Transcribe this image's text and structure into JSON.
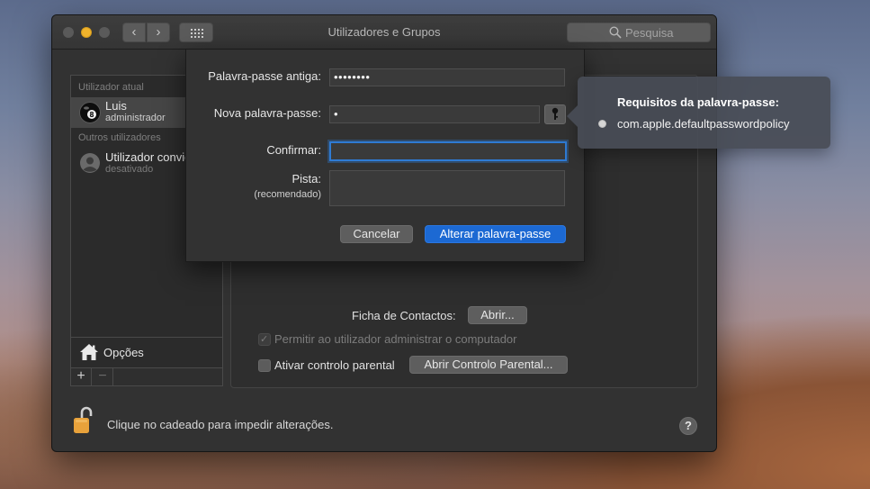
{
  "window": {
    "title": "Utilizadores e Grupos",
    "search_placeholder": "Pesquisa"
  },
  "sidebar": {
    "current_user_section": "Utilizador atual",
    "current_user": {
      "name": "Luis",
      "role": "administrador"
    },
    "other_users_section": "Outros utilizadores",
    "other_users": [
      {
        "name": "Utilizador convidado",
        "role": "desativado"
      }
    ],
    "options_label": "Opções",
    "add_symbol": "+",
    "remove_symbol": "−"
  },
  "main": {
    "contacts_label": "Ficha de Contactos:",
    "open_button": "Abrir...",
    "allow_admin_label": "Permitir ao utilizador administrar o computador",
    "allow_admin_checked": true,
    "parental_label": "Ativar controlo parental",
    "parental_checked": false,
    "parental_button": "Abrir Controlo Parental..."
  },
  "footer": {
    "lock_text": "Clique no cadeado para impedir alterações.",
    "help_symbol": "?"
  },
  "sheet": {
    "old_password_label": "Palavra-passe antiga:",
    "old_password_value": "••••••••",
    "new_password_label": "Nova palavra-passe:",
    "new_password_value": "•",
    "confirm_label": "Confirmar:",
    "confirm_value": "",
    "hint_label": "Pista:",
    "hint_sublabel": "(recomendado)",
    "hint_value": "",
    "cancel_button": "Cancelar",
    "change_button": "Alterar palavra-passe"
  },
  "popover": {
    "title": "Requisitos da palavra-passe:",
    "items": [
      "com.apple.defaultpasswordpolicy"
    ]
  },
  "colors": {
    "accent": "#1c69d3",
    "focus_ring": "#2f7bd4",
    "lock_gold": "#e8a23b",
    "minimize_yellow": "#f0b32c"
  }
}
